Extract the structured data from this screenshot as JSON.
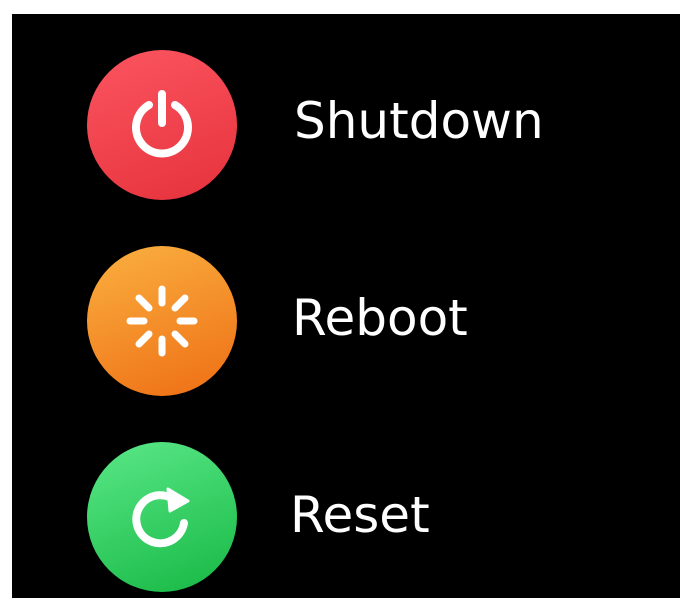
{
  "menu": {
    "items": [
      {
        "id": "shutdown",
        "label": "Shutdown",
        "icon": "power-icon",
        "color_top": "#f94a53",
        "color_bottom": "#e6323c"
      },
      {
        "id": "reboot",
        "label": "Reboot",
        "icon": "loading-spinner-icon",
        "color_top": "#f9a53a",
        "color_bottom": "#ee6e14"
      },
      {
        "id": "reset",
        "label": "Reset",
        "icon": "refresh-icon",
        "color_top": "#52e07c",
        "color_bottom": "#17b844"
      }
    ]
  },
  "colors": {
    "background": "#000000",
    "text": "#ffffff",
    "icon": "#ffffff"
  }
}
